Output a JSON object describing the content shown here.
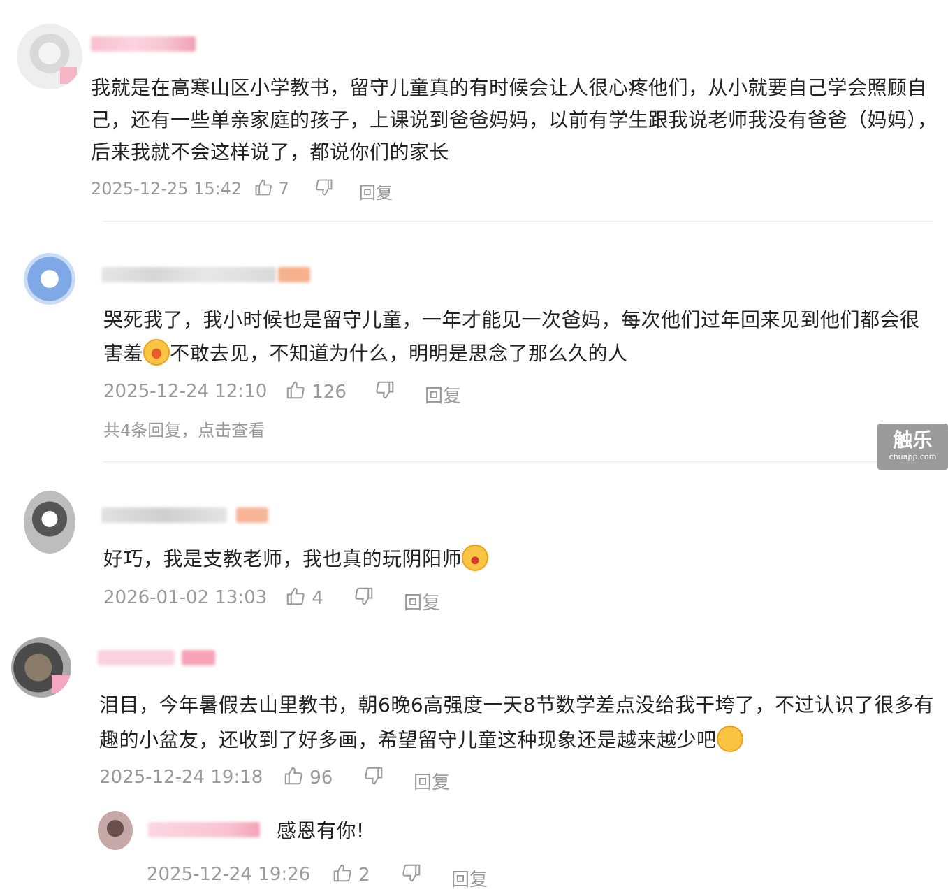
{
  "comments": [
    {
      "text": "我就是在高寒山区小学教书，留守儿童真的有时候会让人很心疼他们，从小就要自己学会照顾自己，还有一些单亲家庭的孩子，上课说到爸爸妈妈，以前有学生跟我说老师我没有爸爸（妈妈），后来我就不会这样说了，都说你们的家长",
      "time": "2025-12-25 15:42",
      "likes": "7",
      "reply_label": "回复"
    },
    {
      "text_before": "哭死我了，我小时候也是留守儿童，一年才能见一次爸妈，每次他们过年回来见到他们都会很害羞",
      "text_after": "不敢去见，不知道为什么，明明是思念了那么久的人",
      "emoji": "crying-face-emoji",
      "time": "2025-12-24 12:10",
      "likes": "126",
      "reply_label": "回复",
      "more_replies": "共4条回复，点击查看"
    },
    {
      "text": "好巧，我是支教老师，我也真的玩阴阳师",
      "emoji": "shocked-face-emoji",
      "time": "2026-01-02 13:03",
      "likes": "4",
      "reply_label": "回复"
    },
    {
      "text": "泪目，今年暑假去山里教书，朝6晚6高强度一天8节数学差点没给我干垮了，不过认识了很多有趣的小盆友，还收到了好多画，希望留守儿童这种现象还是越来越少吧",
      "emoji": "sobbing-face-emoji",
      "time": "2025-12-24 19:18",
      "likes": "96",
      "reply_label": "回复"
    },
    {
      "text": "感恩有你!",
      "time": "2025-12-24 19:26",
      "likes": "2",
      "reply_label": "回复"
    }
  ],
  "watermark": {
    "title": "触乐",
    "subtitle": "chuapp.com"
  },
  "colors": {
    "meta_text": "#9a9a9a",
    "body_text": "#222222",
    "divider": "#e8e8e8"
  }
}
